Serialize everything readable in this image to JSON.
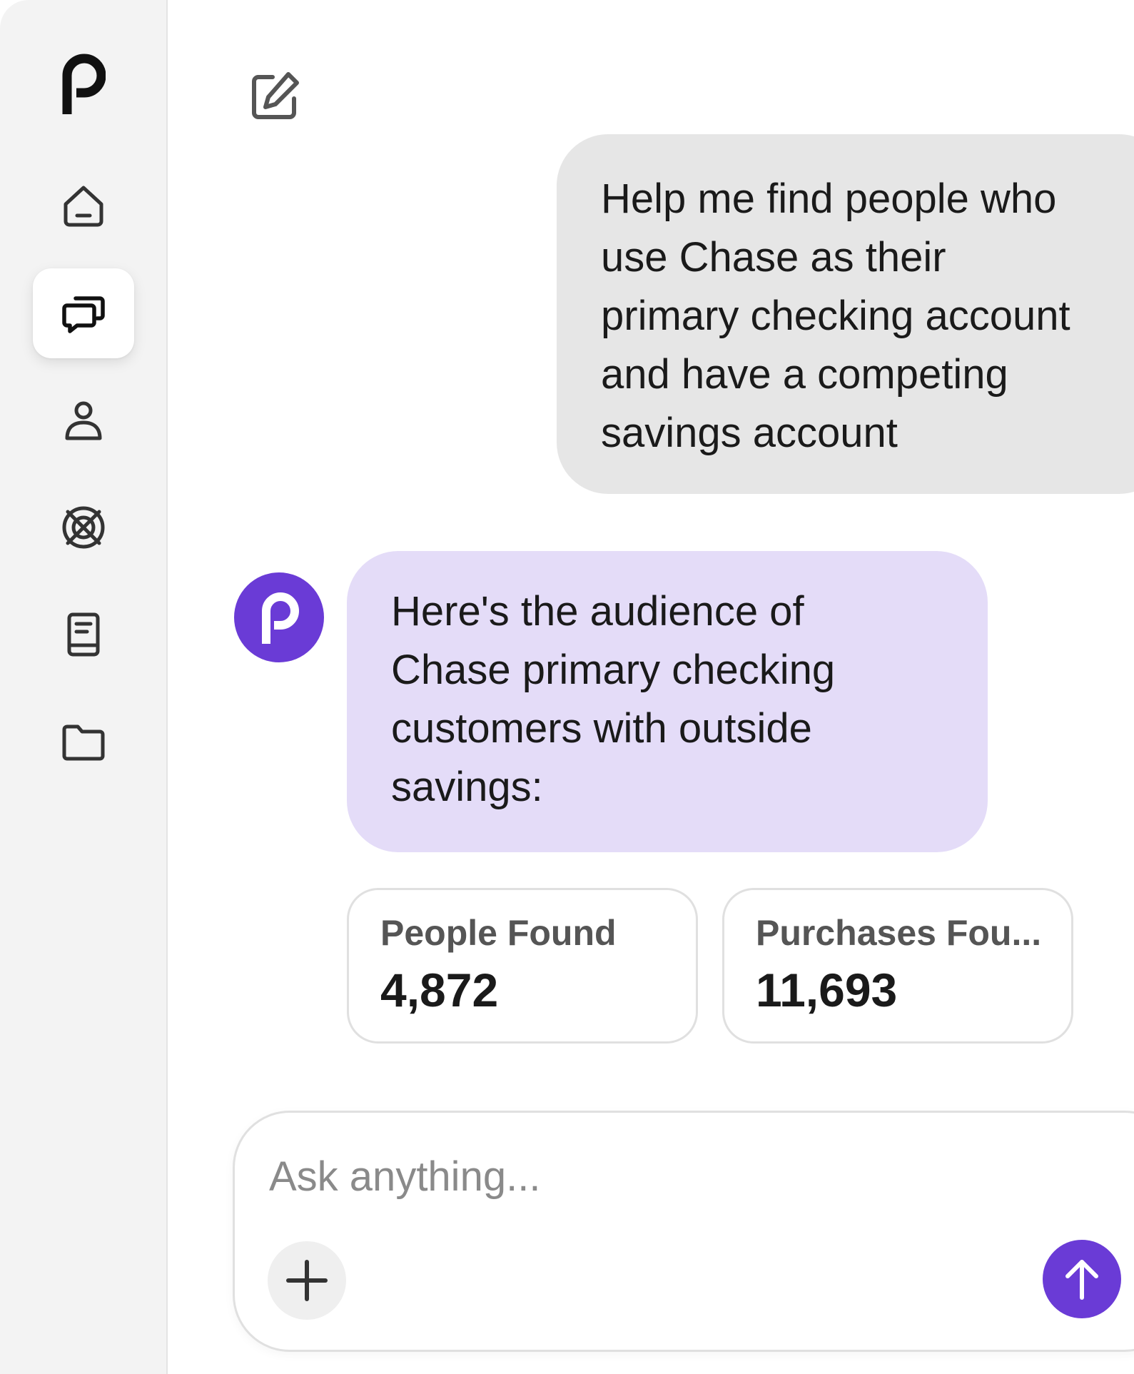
{
  "app": {
    "logo_icon": "p-logo-icon",
    "brand_color": "#6a3bd6"
  },
  "sidebar": {
    "items": [
      {
        "icon": "home-icon",
        "active": false
      },
      {
        "icon": "chat-icon",
        "active": true
      },
      {
        "icon": "person-icon",
        "active": false
      },
      {
        "icon": "target-icon",
        "active": false
      },
      {
        "icon": "book-icon",
        "active": false
      },
      {
        "icon": "folder-icon",
        "active": false
      }
    ]
  },
  "header": {
    "compose_icon": "edit-icon"
  },
  "conversation": {
    "user_message": {
      "lines": [
        "Help me find people who",
        "use Chase as their",
        "primary checking account",
        "and have a competing",
        "savings account"
      ]
    },
    "assistant_message": {
      "avatar_icon": "p-logo-icon",
      "lines": [
        "Here's the audience of",
        "Chase primary checking",
        "customers with outside",
        "savings:"
      ]
    },
    "stats": [
      {
        "label": "People Found",
        "value": "4,872"
      },
      {
        "label": "Purchases Fou...",
        "value": "11,693"
      }
    ]
  },
  "composer": {
    "placeholder": "Ask anything...",
    "value": "",
    "add_icon": "plus-icon",
    "send_icon": "arrow-up-icon"
  }
}
